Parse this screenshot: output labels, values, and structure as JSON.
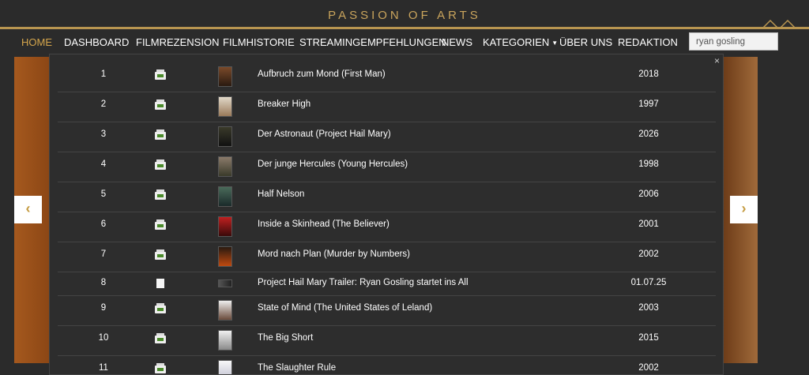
{
  "site": {
    "logo": "PASSION OF ARTS"
  },
  "nav": {
    "items": [
      {
        "label": "HOME",
        "active": true
      },
      {
        "label": "DASHBOARD"
      },
      {
        "label": "FILMREZENSION"
      },
      {
        "label": "FILMHISTORIE"
      },
      {
        "label": "STREAMINGEMPFEHLUNGEN"
      },
      {
        "label": "NEWS"
      },
      {
        "label": "KATEGORIEN",
        "has_dropdown": true
      },
      {
        "label": "ÜBER UNS"
      },
      {
        "label": "REDAKTION"
      }
    ]
  },
  "search": {
    "value": "ryan gosling"
  },
  "dropdown": {
    "close_label": "×",
    "results": [
      {
        "num": "1",
        "type": "film",
        "title": "Aufbruch zum Mond (First Man)",
        "year": "2018"
      },
      {
        "num": "2",
        "type": "film",
        "title": "Breaker High",
        "year": "1997"
      },
      {
        "num": "3",
        "type": "film",
        "title": "Der Astronaut (Project Hail Mary)",
        "year": "2026"
      },
      {
        "num": "4",
        "type": "film",
        "title": "Der junge Hercules (Young Hercules)",
        "year": "1998"
      },
      {
        "num": "5",
        "type": "film",
        "title": "Half Nelson",
        "year": "2006"
      },
      {
        "num": "6",
        "type": "film",
        "title": "Inside a Skinhead (The Believer)",
        "year": "2001"
      },
      {
        "num": "7",
        "type": "film",
        "title": "Mord nach Plan (Murder by Numbers)",
        "year": "2002"
      },
      {
        "num": "8",
        "type": "article",
        "title": "Project Hail Mary Trailer: Ryan Gosling startet ins All",
        "year": "01.07.25"
      },
      {
        "num": "9",
        "type": "film",
        "title": "State of Mind (The United States of Leland)",
        "year": "2003"
      },
      {
        "num": "10",
        "type": "film",
        "title": "The Big Short",
        "year": "2015"
      },
      {
        "num": "11",
        "type": "film",
        "title": "The Slaughter Rule",
        "year": "2002"
      }
    ]
  },
  "slider": {
    "prev_label": "‹",
    "next_label": "›"
  },
  "colors": {
    "accent": "#d4a54c",
    "background": "#2b2b2b",
    "brand_gold": "#b89550"
  }
}
